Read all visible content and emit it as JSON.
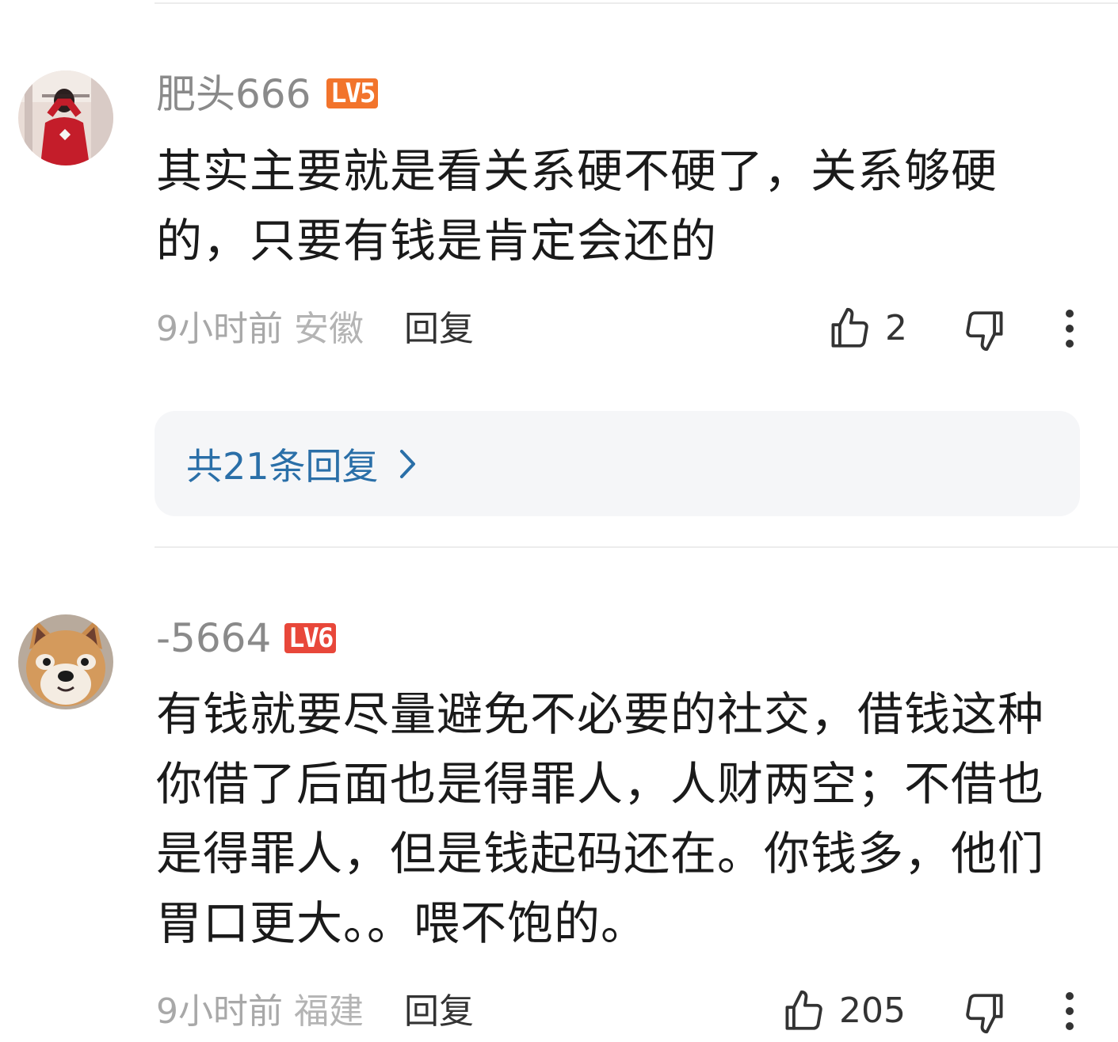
{
  "comments": [
    {
      "username": "肥头666",
      "level": "LV5",
      "content": "其实主要就是看关系硬不硬了，关系够硬的，只要有钱是肯定会还的",
      "time": "9小时前",
      "location": "安徽",
      "reply_label": "回复",
      "likes": "2",
      "view_replies": "共21条回复"
    },
    {
      "username": "-5664",
      "level": "LV6",
      "content": "有钱就要尽量避免不必要的社交，借钱这种你借了后面也是得罪人，人财两空；不借也是得罪人，但是钱起码还在。你钱多，他们胃口更大。。喂不饱的。",
      "time": "9小时前",
      "location": "福建",
      "reply_label": "回复",
      "likes": "205"
    }
  ],
  "icons": {
    "like": "thumbs-up-icon",
    "dislike": "thumbs-down-icon",
    "more": "more-vertical-icon",
    "chevron": "chevron-right-icon"
  },
  "colors": {
    "level5": "#f2742c",
    "level6": "#e8473a",
    "link": "#2a6fa8"
  }
}
